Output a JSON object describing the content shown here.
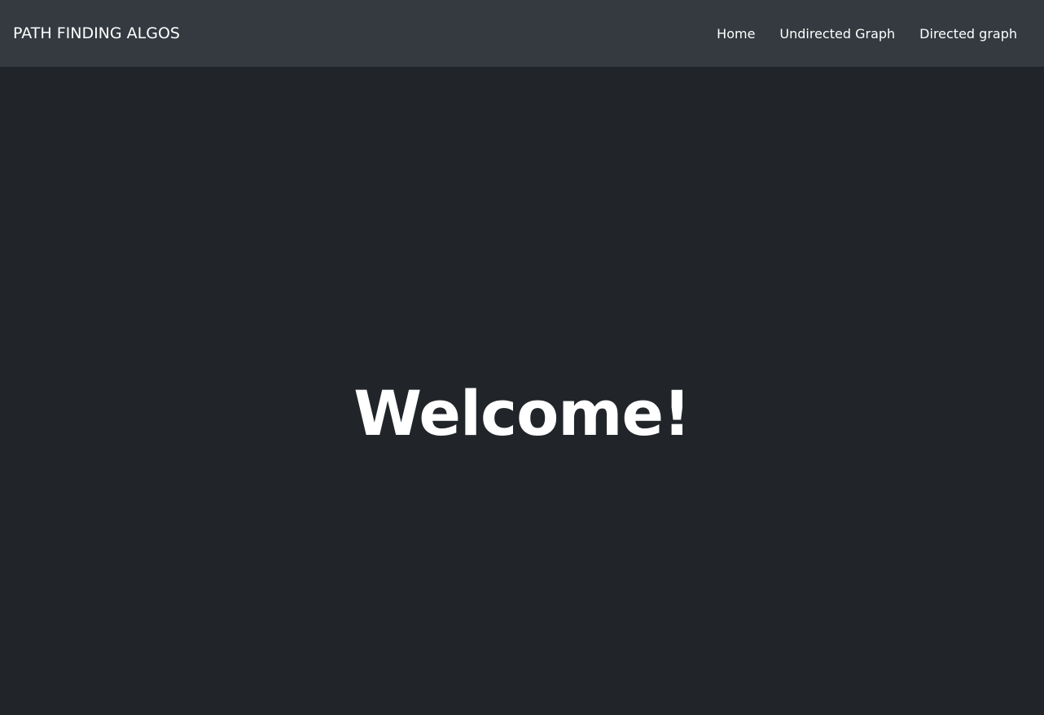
{
  "navbar": {
    "brand": "PATH FINDING ALGOS",
    "links": [
      {
        "label": "Home"
      },
      {
        "label": "Undirected Graph"
      },
      {
        "label": "Directed graph"
      }
    ],
    "background_color": "#343a40",
    "text_color": "#ffffff"
  },
  "main": {
    "heading": "Welcome!",
    "background_color": "#212529"
  }
}
